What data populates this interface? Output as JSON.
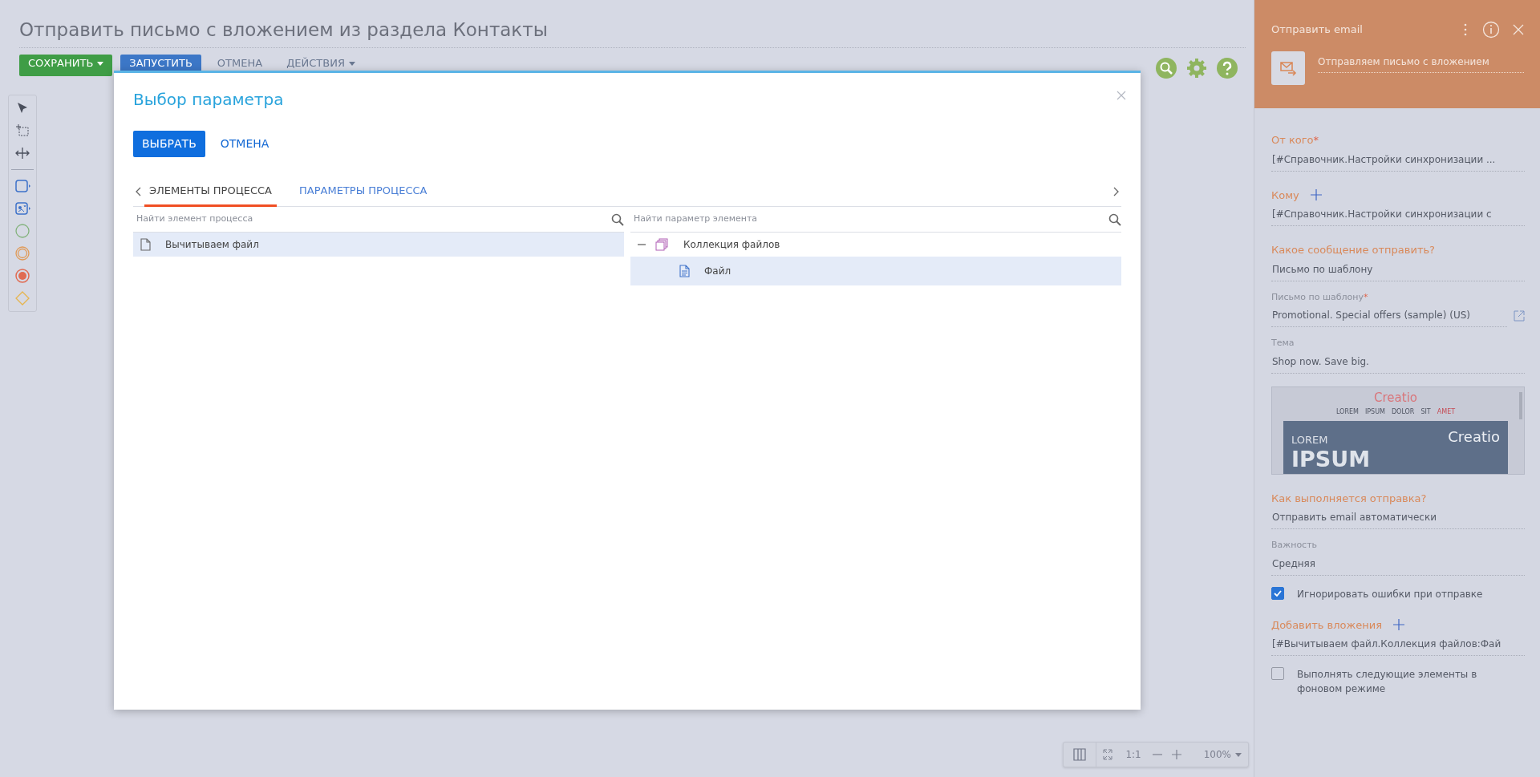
{
  "page": {
    "title": "Отправить письмо с вложением из раздела Контакты",
    "toolbar": [
      {
        "label": "СОХРАНИТЬ",
        "kind": "success",
        "caret": true
      },
      {
        "label": "ЗАПУСТИТЬ",
        "kind": "primary",
        "caret": false
      },
      {
        "label": "ОТМЕНА",
        "kind": "link",
        "caret": false
      },
      {
        "label": "ДЕЙСТВИЯ",
        "kind": "link",
        "caret": true
      }
    ]
  },
  "zoom_bar": {
    "scale": "1:1",
    "zoom": "100%"
  },
  "dialog": {
    "title": "Выбор параметра",
    "buttons": [
      {
        "label": "ВЫБРАТЬ",
        "kind": "primary"
      },
      {
        "label": "ОТМЕНА",
        "kind": "link"
      }
    ],
    "tabs": [
      {
        "label": "ЭЛЕМЕНТЫ ПРОЦЕССА",
        "selected": true
      },
      {
        "label": "ПАРАМЕТРЫ ПРОЦЕССА",
        "selected": false
      }
    ],
    "left": {
      "placeholder": "Найти элемент процесса",
      "items": [
        {
          "label": "Вычитываем файл",
          "selected": true
        }
      ]
    },
    "right": {
      "placeholder": "Найти параметр элемента",
      "items": [
        {
          "label": "Коллекция файлов",
          "expanded": true,
          "selected": false,
          "children": [
            {
              "label": "Файл",
              "selected": true
            }
          ]
        }
      ]
    }
  },
  "panel": {
    "title": "Отправить email",
    "element_name": "Отправляем письмо с вложением",
    "fields": [
      {
        "kind": "section",
        "label": "От кого",
        "required_mark": "*",
        "value": "[#Справочник.Настройки синхронизации ..."
      },
      {
        "kind": "section",
        "label": "Кому",
        "add": true,
        "value": "[#Справочник.Настройки синхронизации с"
      },
      {
        "kind": "section",
        "label": "Какое сообщение отправить?",
        "value": "Письмо по шаблону"
      },
      {
        "kind": "field",
        "label": "Письмо по шаблону",
        "required_mark": "*",
        "open_link": true,
        "value": "Promotional. Special offers (sample) (US)"
      },
      {
        "kind": "field",
        "label": "Тема",
        "value": "Shop now. Save big."
      },
      {
        "kind": "preview",
        "logo": "Creatio",
        "nav": [
          {
            "label": "LOREM",
            "active": false
          },
          {
            "label": "IPSUM",
            "active": false
          },
          {
            "label": "DOLOR",
            "active": false
          },
          {
            "label": "SIT",
            "active": false
          },
          {
            "label": "AMET",
            "active": true
          }
        ],
        "headline": "LOREM",
        "big": "IPSUM",
        "banner_logo": "Creatio"
      },
      {
        "kind": "section",
        "label": "Как выполняется отправка?",
        "value": "Отправить email автоматически"
      },
      {
        "kind": "field",
        "label": "Важность",
        "value": "Средняя"
      },
      {
        "kind": "checkbox",
        "label": "Игнорировать ошибки при отправке",
        "checked": true
      },
      {
        "kind": "section",
        "label": "Добавить вложения",
        "add": true,
        "value": "[#Вычитываем файл.Коллекция файлов:Фай"
      },
      {
        "kind": "checkbox",
        "label": "Выполнять следующие элементы в фоновом режиме",
        "checked": false
      }
    ]
  }
}
